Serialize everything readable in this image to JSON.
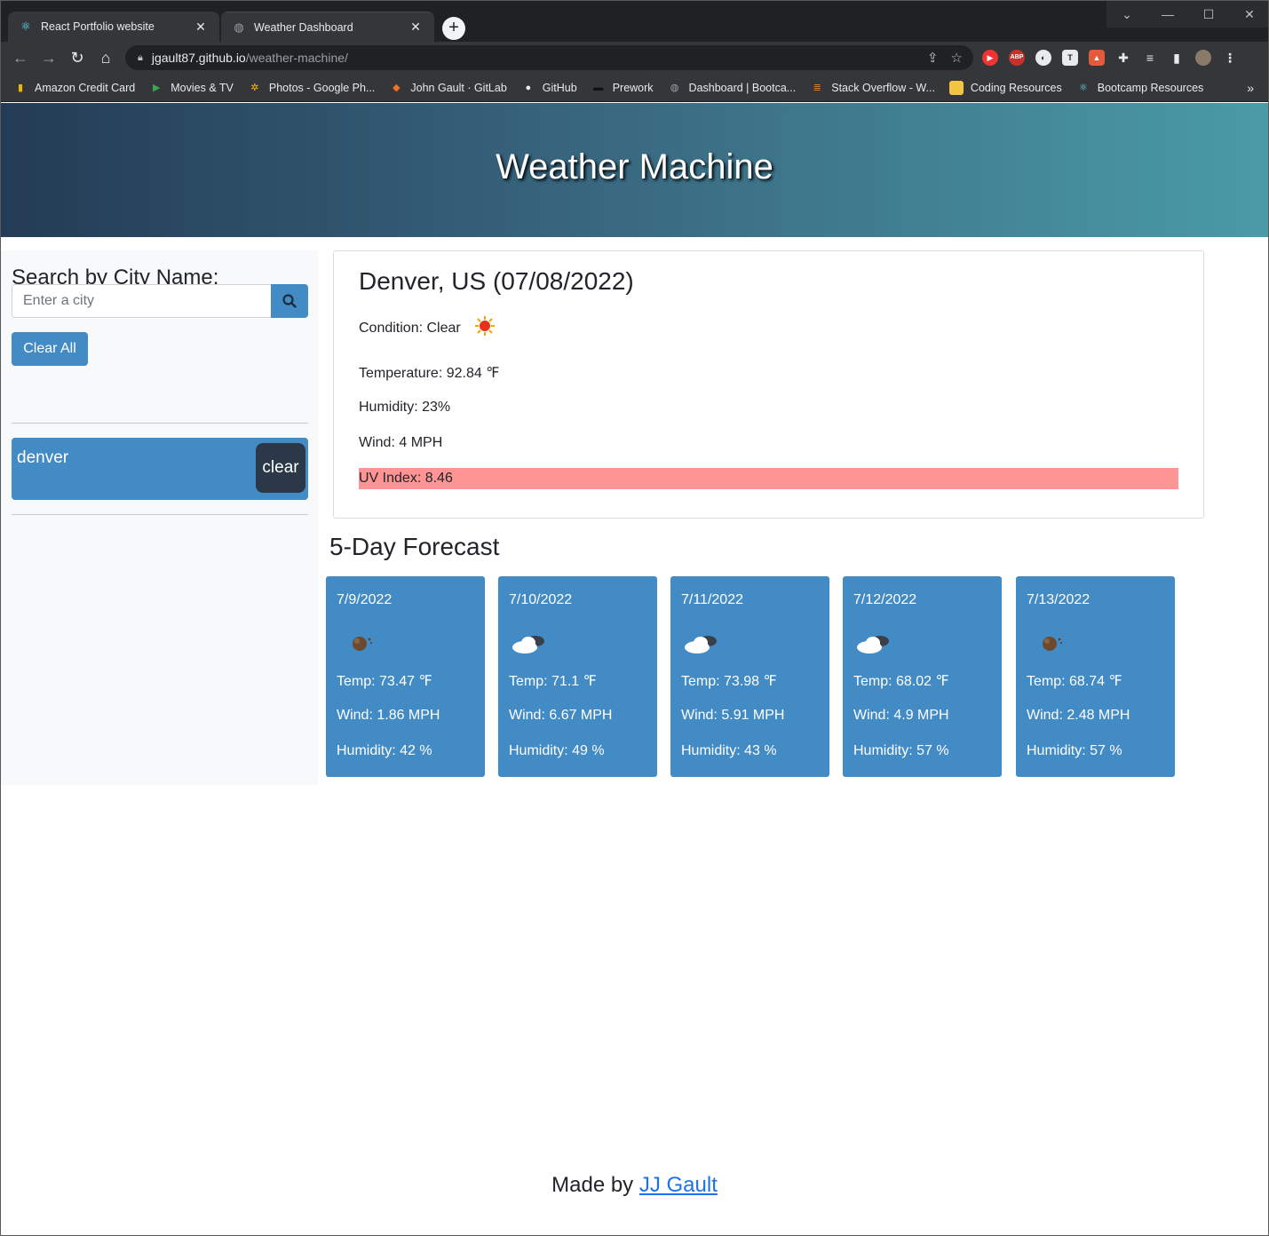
{
  "browser": {
    "tabs": [
      {
        "title": "React Portfolio website",
        "active": false
      },
      {
        "title": "Weather Dashboard",
        "active": true
      }
    ],
    "url_host": "jgault87.github.io",
    "url_path": "/weather-machine/",
    "bookmarks": [
      {
        "label": "Amazon Credit Card",
        "icon": "chart-bars-icon"
      },
      {
        "label": "Movies & TV",
        "icon": "play-icon"
      },
      {
        "label": "Photos - Google Ph...",
        "icon": "pinwheel-icon"
      },
      {
        "label": "John Gault · GitLab",
        "icon": "gitlab-icon"
      },
      {
        "label": "GitHub",
        "icon": "github-icon"
      },
      {
        "label": "Prework",
        "icon": "book-icon"
      },
      {
        "label": "Dashboard | Bootca...",
        "icon": "globe-icon"
      },
      {
        "label": "Stack Overflow - W...",
        "icon": "stackoverflow-icon"
      },
      {
        "label": "Coding Resources",
        "icon": "folder-icon"
      },
      {
        "label": "Bootcamp Resources",
        "icon": "react-icon"
      }
    ]
  },
  "header": {
    "title": "Weather Machine"
  },
  "sidebar": {
    "heading": "Search by City Name:",
    "search_placeholder": "Enter a city",
    "clear_all_label": "Clear All",
    "history": [
      {
        "city": "denver",
        "clear_label": "clear"
      }
    ]
  },
  "current": {
    "title": "Denver, US (07/08/2022)",
    "condition": "Condition: Clear",
    "temperature": "Temperature: 92.84 ℉",
    "humidity": "Humidity: 23%",
    "wind": "Wind: 4 MPH",
    "uv": "UV Index: 8.46",
    "uv_color": "#ff9494"
  },
  "forecast": {
    "title": "5-Day Forecast",
    "days": [
      {
        "date": "7/9/2022",
        "icon": "moon-icon",
        "temp": "Temp: 73.47 ℉",
        "wind": "Wind: 1.86 MPH",
        "humidity": "Humidity: 42 %"
      },
      {
        "date": "7/10/2022",
        "icon": "cloud-icon",
        "temp": "Temp: 71.1 ℉",
        "wind": "Wind: 6.67 MPH",
        "humidity": "Humidity: 49 %"
      },
      {
        "date": "7/11/2022",
        "icon": "cloud-icon",
        "temp": "Temp: 73.98 ℉",
        "wind": "Wind: 5.91 MPH",
        "humidity": "Humidity: 43 %"
      },
      {
        "date": "7/12/2022",
        "icon": "cloud-icon",
        "temp": "Temp: 68.02 ℉",
        "wind": "Wind: 4.9 MPH",
        "humidity": "Humidity: 57 %"
      },
      {
        "date": "7/13/2022",
        "icon": "moon-icon",
        "temp": "Temp: 68.74 ℉",
        "wind": "Wind: 2.48 MPH",
        "humidity": "Humidity: 57 %"
      }
    ]
  },
  "footer": {
    "prefix": "Made by ",
    "link": "JJ Gault "
  },
  "colors": {
    "accent": "#438bc4",
    "dark_button": "#2a3847"
  }
}
